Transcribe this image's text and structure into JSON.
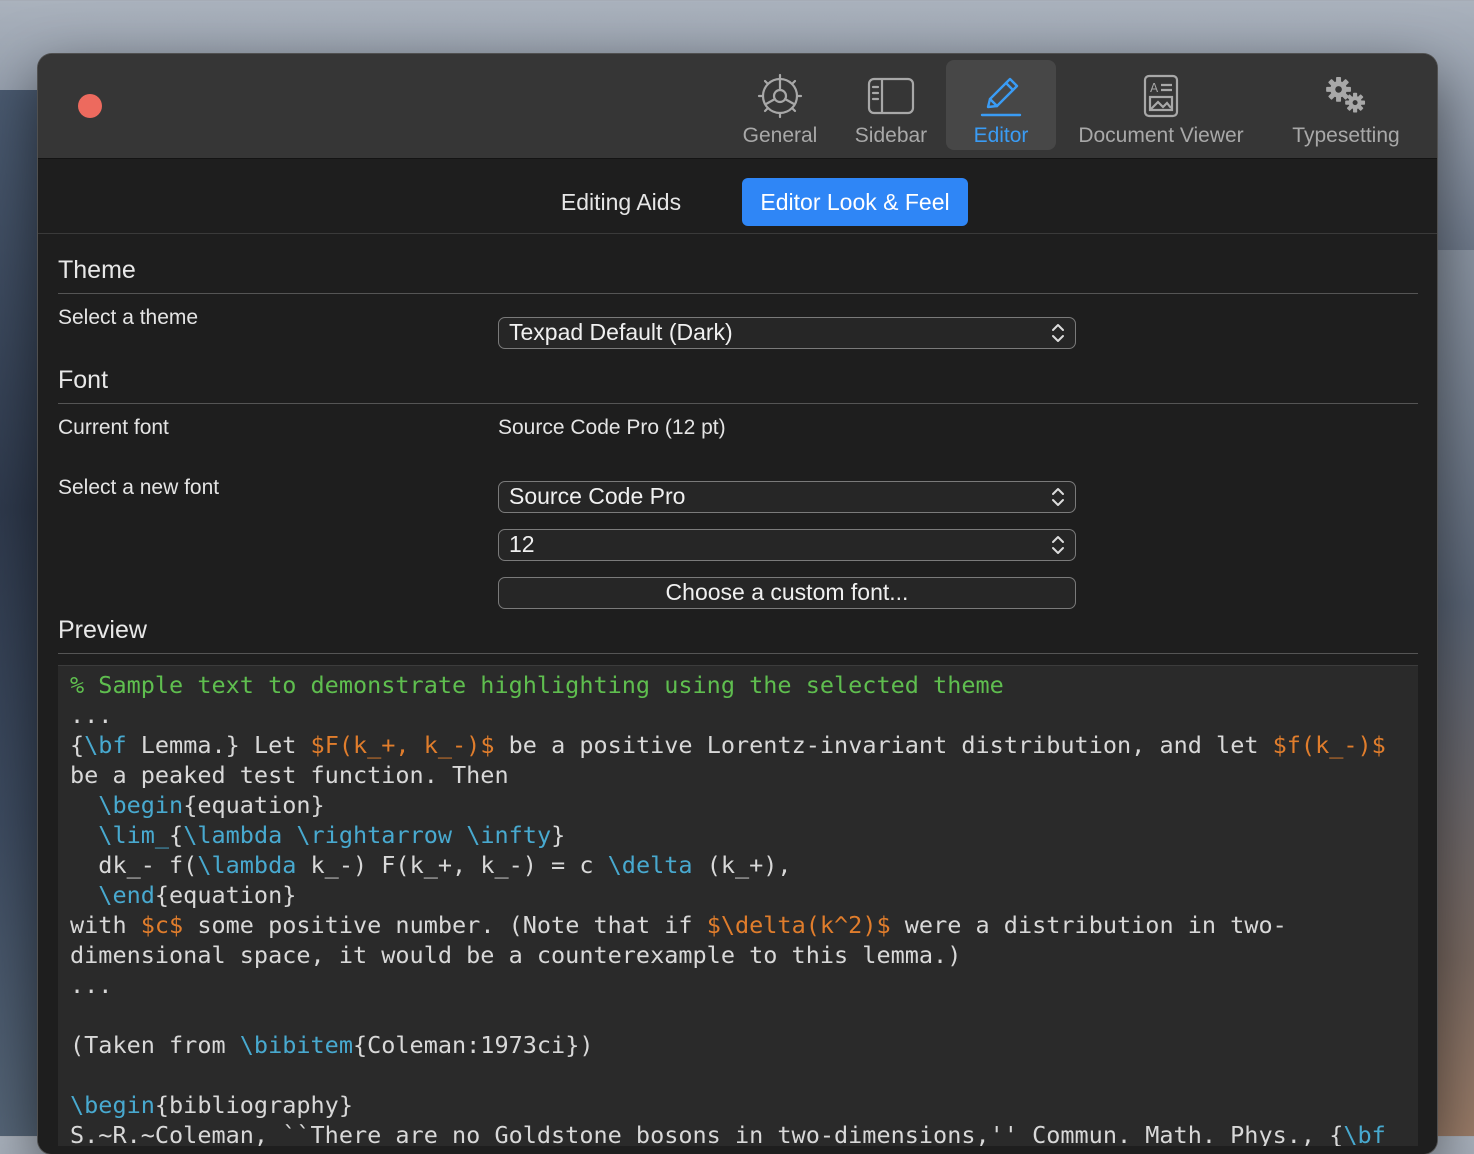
{
  "toolbar": {
    "items": [
      {
        "label": "General",
        "icon": "gear-icon"
      },
      {
        "label": "Sidebar",
        "icon": "sidebar-icon"
      },
      {
        "label": "Editor",
        "icon": "pencil-icon",
        "active": true
      },
      {
        "label": "Document Viewer",
        "icon": "document-icon"
      },
      {
        "label": "Typesetting",
        "icon": "gears-icon"
      }
    ]
  },
  "segments": {
    "editing_aids": "Editing Aids",
    "look_and_feel": "Editor Look & Feel",
    "selected": "look_and_feel"
  },
  "theme": {
    "section_title": "Theme",
    "select_label": "Select a theme",
    "selected_theme": "Texpad Default (Dark)"
  },
  "font": {
    "section_title": "Font",
    "current_label": "Current font",
    "current_value": "Source Code Pro (12 pt)",
    "select_label": "Select a new font",
    "family": "Source Code Pro",
    "size": "12",
    "custom_button": "Choose a custom font..."
  },
  "preview": {
    "section_title": "Preview",
    "colors": {
      "comment": "#5fbe4f",
      "keyword": "#48a9cf",
      "math": "#e07d2c",
      "text": "#d8d8d8"
    },
    "lines": [
      [
        [
          "c",
          "% Sample text to demonstrate highlighting using the selected theme"
        ]
      ],
      [
        [
          "t",
          "..."
        ]
      ],
      [
        [
          "t",
          "{"
        ],
        [
          "k",
          "\\bf"
        ],
        [
          "t",
          " Lemma.} Let "
        ],
        [
          "m",
          "$F(k_+, k_-)$"
        ],
        [
          "t",
          " be a positive Lorentz-invariant distribution, and let "
        ],
        [
          "m",
          "$f(k_-)$"
        ]
      ],
      [
        [
          "t",
          "be a peaked test function. Then"
        ]
      ],
      [
        [
          "t",
          "  "
        ],
        [
          "k",
          "\\begin"
        ],
        [
          "t",
          "{equation}"
        ]
      ],
      [
        [
          "t",
          "  "
        ],
        [
          "k",
          "\\lim_"
        ],
        [
          "t",
          "{"
        ],
        [
          "k",
          "\\lambda"
        ],
        [
          "t",
          " "
        ],
        [
          "k",
          "\\rightarrow"
        ],
        [
          "t",
          " "
        ],
        [
          "k",
          "\\infty"
        ],
        [
          "t",
          "}"
        ]
      ],
      [
        [
          "t",
          "  dk_- f("
        ],
        [
          "k",
          "\\lambda"
        ],
        [
          "t",
          " k_-) F(k_+, k_-) = c "
        ],
        [
          "k",
          "\\delta"
        ],
        [
          "t",
          " (k_+),"
        ]
      ],
      [
        [
          "t",
          "  "
        ],
        [
          "k",
          "\\end"
        ],
        [
          "t",
          "{equation}"
        ]
      ],
      [
        [
          "t",
          "with "
        ],
        [
          "m",
          "$c$"
        ],
        [
          "t",
          " some positive number. (Note that if "
        ],
        [
          "m",
          "$\\delta(k^2)$"
        ],
        [
          "t",
          " were a distribution in two-"
        ]
      ],
      [
        [
          "t",
          "dimensional space, it would be a counterexample to this lemma.)"
        ]
      ],
      [
        [
          "t",
          "..."
        ]
      ],
      [
        [
          "t",
          ""
        ]
      ],
      [
        [
          "t",
          "(Taken from "
        ],
        [
          "k",
          "\\bibitem"
        ],
        [
          "t",
          "{Coleman:1973ci})"
        ]
      ],
      [
        [
          "t",
          ""
        ]
      ],
      [
        [
          "k",
          "\\begin"
        ],
        [
          "t",
          "{bibliography}"
        ]
      ],
      [
        [
          "t",
          "S.~R.~Coleman, ``There are no Goldstone bosons in two-dimensions,'' Commun. Math. Phys., {"
        ],
        [
          "k",
          "\\bf"
        ]
      ]
    ]
  }
}
